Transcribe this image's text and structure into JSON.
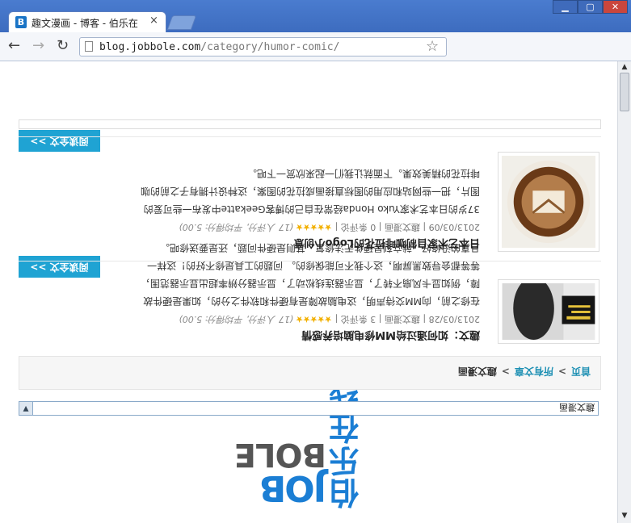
{
  "browser": {
    "tab_title": "趣文漫画 - 博客 - 伯乐在",
    "tab_favicon": "B",
    "tab_close": "×",
    "url_domain": "blog.jobbole.com",
    "url_path": "/category/humor-comic/",
    "back_icon": "back-arrow-icon",
    "forward_icon": "forward-arrow-icon",
    "reload_icon": "reload-icon",
    "star_icon": "bookmark-star-icon",
    "min": "▁",
    "max": "▢",
    "close": "✕"
  },
  "logo": {
    "cn": "伯乐在线",
    "en_top": "JOB",
    "en_bottom": "BOLE"
  },
  "category_select": {
    "value": "趣文漫画"
  },
  "breadcrumb": {
    "home": "首页",
    "sep1": ">",
    "all": "所有文章",
    "sep2": ">",
    "current": "趣文漫画"
  },
  "posts": [
    {
      "title": "趣文：如何通过给MM修电脑培养感情",
      "meta_date": "2013/03/28",
      "meta_cat": "趣文漫画",
      "meta_comments": "3 条评论",
      "stars": "★★★★★",
      "score": "(17 人评分, 平均得分: 5.00)",
      "excerpt": "在修之前，向MM交待声明，这电脑故障是有硬件和软件之分的，如果是硬件故障，例如显卡风扇不转了，显示器连线松动了，显示器分辨率超出显示器范围，等等都会导致黑屏啊，这个我不可能保修的。 问题的工具是修不好的！这样一旦真的没修好，就立刻是硬件无法修复，其则是硬件问题，还是要送修吧。",
      "readmore": "阅读全文 >>"
    },
    {
      "title": "日本艺术家自制咖啡拉花的Logo小创意",
      "meta_date": "2013/03/09",
      "meta_cat": "趣文漫画",
      "meta_comments": "0 条评论",
      "stars": "★★★★★",
      "score": "(17 人评分, 平均得分: 5.00)",
      "excerpt": "37岁的日本艺术家Yuko Honda经常在自己的博客Geekatte中发布一些可爱的图片，把一些网站和应用的图标直接画成拉花的图案，这种设计拥有子之前的咖啡拉花的精美效果。下面就让我们一起来欣赏一下吧。",
      "readmore": "阅读全文 >>"
    }
  ]
}
